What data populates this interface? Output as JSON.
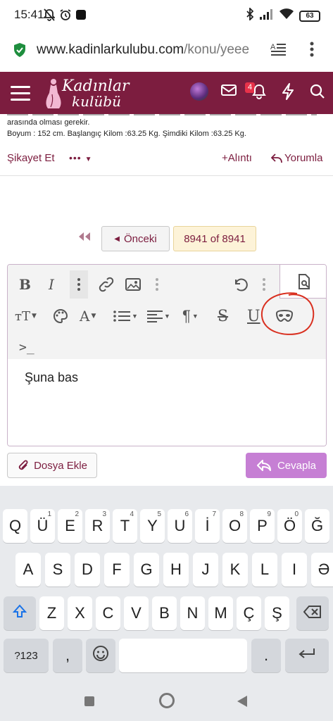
{
  "status_bar": {
    "time": "15:41",
    "battery": "63"
  },
  "browser": {
    "url_domain": "www.kadinlarkulubu.com",
    "url_path": "/konu/yeee"
  },
  "site": {
    "logo_line1": "Kadınlar",
    "logo_line2": "kulübü",
    "notification_count": "4",
    "brand_color": "#7c1d3f"
  },
  "post": {
    "line_partial": "arasında olması gerekir.",
    "line_stats": "Boyum : 152 cm. Başlangıç Kilom :63.25 Kg. Şimdiki Kilom :63.25 Kg.",
    "report_label": "Şikayet Et",
    "more_label": "•••",
    "quote_label": "Alıntı",
    "comment_label": "Yorumla"
  },
  "pagination": {
    "prev_label": "Önceki",
    "current_label": "8941 of 8941"
  },
  "editor": {
    "content": "Şuna bas"
  },
  "actions": {
    "attach_label": "Dosya Ekle",
    "reply_label": "Cevapla",
    "reply_color": "#c67fd4"
  },
  "keyboard": {
    "row1": [
      "Q",
      "Ü",
      "E",
      "R",
      "T",
      "Y",
      "U",
      "İ",
      "O",
      "P",
      "Ö",
      "Ğ"
    ],
    "row1_hints": [
      "",
      "1",
      "2",
      "3",
      "4",
      "5",
      "6",
      "7",
      "8",
      "9",
      "0",
      ""
    ],
    "row2": [
      "A",
      "S",
      "D",
      "F",
      "G",
      "H",
      "J",
      "K",
      "L",
      "I",
      "Ə"
    ],
    "row3": [
      "Z",
      "X",
      "C",
      "V",
      "B",
      "N",
      "M",
      "Ç",
      "Ş"
    ],
    "symbols_label": "?123",
    "comma_label": ",",
    "period_label": "."
  }
}
